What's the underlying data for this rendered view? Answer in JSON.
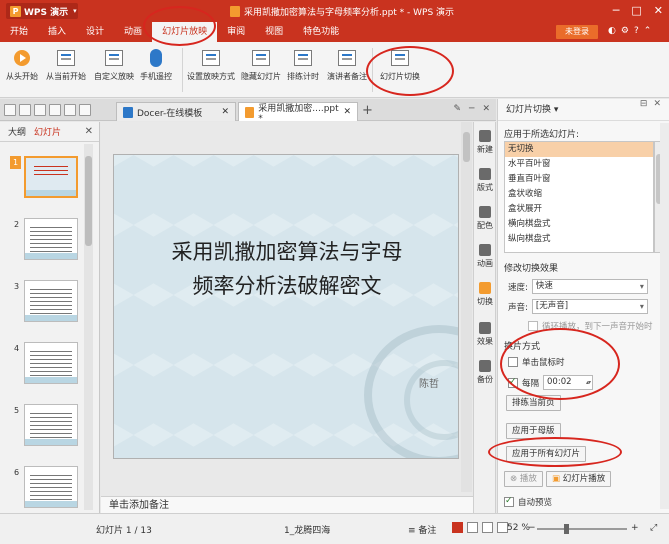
{
  "app": {
    "name": "WPS 演示",
    "doc_title": "采用凯撒加密算法与字母频率分析.ppt * - WPS 演示"
  },
  "menu": {
    "items": [
      "开始",
      "插入",
      "设计",
      "动画",
      "幻灯片放映",
      "审阅",
      "视图",
      "特色功能"
    ],
    "login": "未登录"
  },
  "ribbon": {
    "buttons": [
      "从头开始",
      "从当前开始",
      "自定义放映",
      "手机遥控",
      "设置放映方式",
      "隐藏幻灯片",
      "排练计时",
      "演讲者备注",
      "幻灯片切换"
    ]
  },
  "tabs": {
    "tab1": "Docer-在线模板",
    "tab2": "采用凯撒加密....ppt *"
  },
  "left_panel": {
    "tab_outline": "大纲",
    "tab_slides": "幻灯片",
    "slide_numbers": [
      "1",
      "2",
      "3",
      "4",
      "5",
      "6"
    ]
  },
  "slide": {
    "title_line1": "采用凯撒加密算法与字母",
    "title_line2": "频率分析法破解密文",
    "author": "陈哲"
  },
  "notes_placeholder": "单击添加备注",
  "icon_sidebar": [
    "新建",
    "版式",
    "配色",
    "动画",
    "切换",
    "效果",
    "备份"
  ],
  "task_pane": {
    "header": "幻灯片切换 ▾",
    "apply_label": "应用于所选幻灯片:",
    "transitions": [
      "无切换",
      "水平百叶窗",
      "垂直百叶窗",
      "盒状收缩",
      "盒状展开",
      "横向棋盘式",
      "纵向棋盘式"
    ],
    "modify_label": "修改切换效果",
    "speed_label": "速度:",
    "speed_value": "快速",
    "sound_label": "声音:",
    "sound_value": "[无声音]",
    "loop_label": "循环播放，到下一声音开始时",
    "advance_label": "换片方式",
    "on_click_label": "单击鼠标时",
    "every_label": "每隔",
    "every_value": "00:02",
    "rehearse_button": "排练当前页",
    "apply_master_button": "应用于母版",
    "apply_all_button": "应用于所有幻灯片",
    "play_button": "播放",
    "slideshow_button": "幻灯片播放",
    "autopreview_label": "自动预览"
  },
  "status": {
    "slide_count": "幻灯片 1 / 13",
    "theme": "1_龙腾四海",
    "notes": "备注",
    "zoom": "52 %"
  },
  "colors": {
    "accent": "#c9331f",
    "orange": "#f39b2f",
    "annotation": "#d7261e"
  }
}
